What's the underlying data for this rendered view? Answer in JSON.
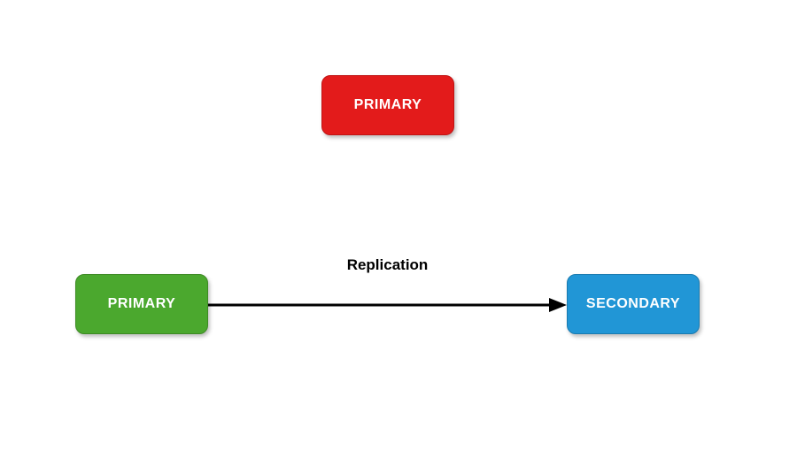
{
  "nodes": {
    "top": {
      "label": "PRIMARY",
      "color": "#e31b1b"
    },
    "left": {
      "label": "PRIMARY",
      "color": "#4ba82e"
    },
    "right": {
      "label": "SECONDARY",
      "color": "#2196d6"
    }
  },
  "edge": {
    "label": "Replication"
  }
}
